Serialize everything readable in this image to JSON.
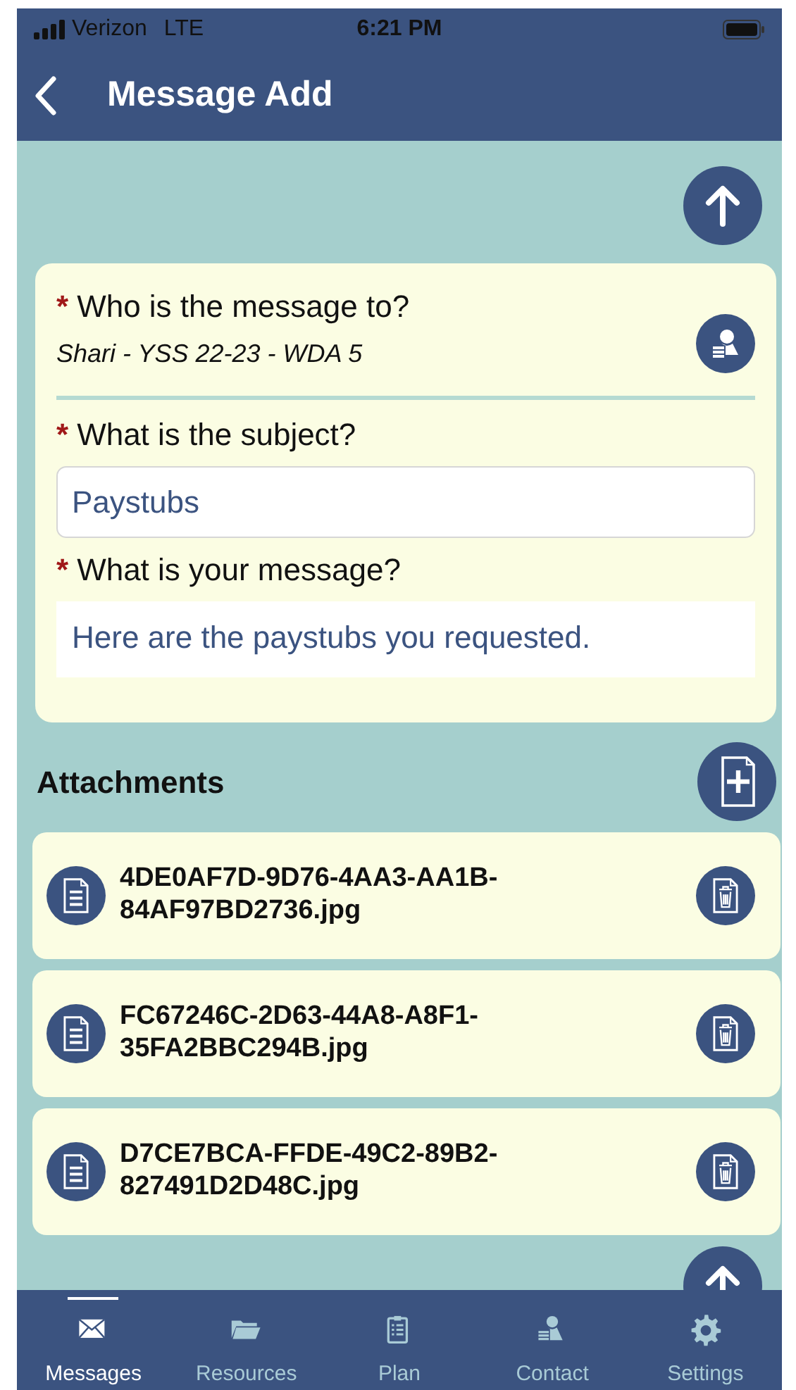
{
  "status_bar": {
    "carrier": "Verizon",
    "network": "LTE",
    "time": "6:21 PM"
  },
  "header": {
    "title": "Message Add"
  },
  "form": {
    "fields": [
      {
        "kind": "picker",
        "required_mark": "*",
        "label": "Who is the message to?",
        "value": "Shari - YSS 22-23 - WDA 5"
      },
      {
        "kind": "text",
        "required_mark": "*",
        "label": "What is the subject?",
        "value": "Paystubs"
      },
      {
        "kind": "textarea",
        "required_mark": "*",
        "label": "What is your message?",
        "value": "Here are the paystubs you requested."
      }
    ]
  },
  "attachments": {
    "title": "Attachments",
    "items": [
      {
        "filename": "4DE0AF7D-9D76-4AA3-AA1B-84AF97BD2736.jpg"
      },
      {
        "filename": "FC67246C-2D63-44A8-A8F1-35FA2BBC294B.jpg"
      },
      {
        "filename": "D7CE7BCA-FFDE-49C2-89B2-827491D2D48C.jpg"
      }
    ]
  },
  "tabs": [
    {
      "label": "Messages",
      "selected": true
    },
    {
      "label": "Resources",
      "selected": false
    },
    {
      "label": "Plan",
      "selected": false
    },
    {
      "label": "Contact",
      "selected": false
    },
    {
      "label": "Settings",
      "selected": false
    }
  ]
}
